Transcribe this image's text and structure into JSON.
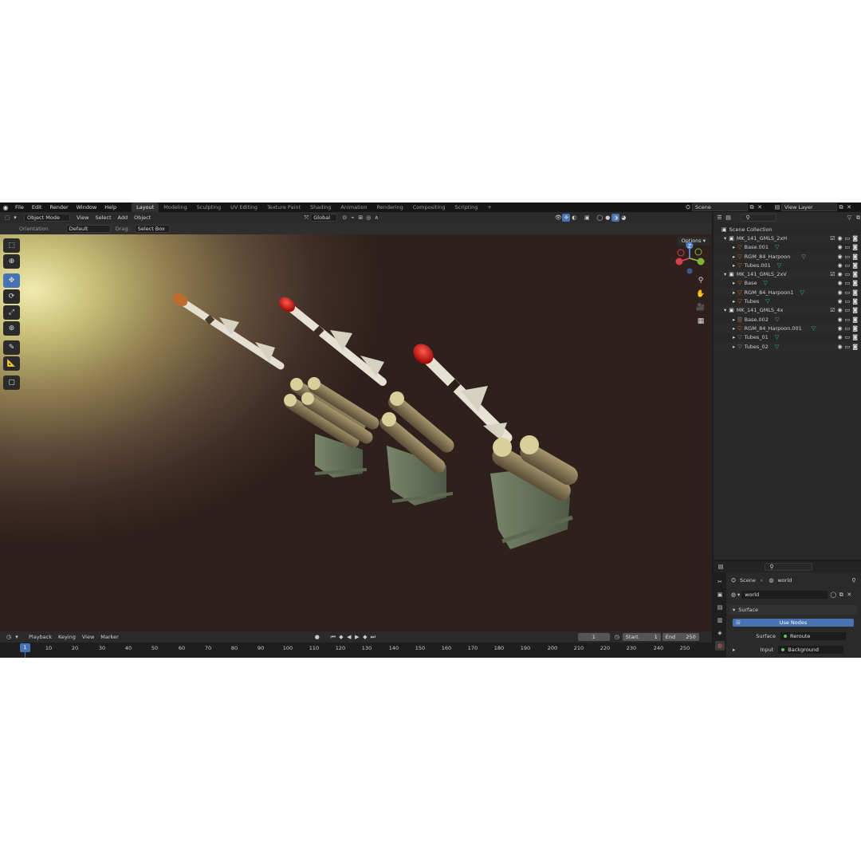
{
  "topbar": {
    "menu": [
      "File",
      "Edit",
      "Render",
      "Window",
      "Help"
    ],
    "workspaces": [
      "Layout",
      "Modeling",
      "Sculpting",
      "UV Editing",
      "Texture Paint",
      "Shading",
      "Animation",
      "Rendering",
      "Compositing",
      "Scripting"
    ],
    "add_tab": "+",
    "scene": "Scene",
    "view_layer": "View Layer"
  },
  "header": {
    "mode": "Object Mode",
    "menu": [
      "View",
      "Select",
      "Add",
      "Object"
    ],
    "transform_orientation": "Global"
  },
  "tool_settings": {
    "orientation_label": "Orientation",
    "orientation_value": "Default",
    "drag_label": "Drag:",
    "drag_value": "Select Box",
    "options": "Options"
  },
  "gizmo": {
    "x": "X",
    "y": "Y",
    "z": "Z"
  },
  "timeline": {
    "menu": [
      "Playback",
      "Keying",
      "View",
      "Marker"
    ],
    "current_frame": "1",
    "start_label": "Start",
    "start": "1",
    "end_label": "End",
    "end": "250",
    "playhead": "1",
    "ticks": [
      "10",
      "20",
      "30",
      "40",
      "50",
      "60",
      "70",
      "80",
      "90",
      "100",
      "110",
      "120",
      "130",
      "140",
      "150",
      "160",
      "170",
      "180",
      "190",
      "200",
      "210",
      "220",
      "230",
      "240",
      "250"
    ]
  },
  "outliner": {
    "root": "Scene Collection",
    "items": [
      {
        "label": "MK_141_GMLS_2xH",
        "type": "collection",
        "level": 1
      },
      {
        "label": "Base.001",
        "type": "object",
        "level": 2
      },
      {
        "label": "RGM_84_Harpoon",
        "type": "object",
        "level": 2
      },
      {
        "label": "Tubes.001",
        "type": "object",
        "level": 2
      },
      {
        "label": "MK_141_GMLS_2xV",
        "type": "collection",
        "level": 1
      },
      {
        "label": "Base",
        "type": "object",
        "level": 2
      },
      {
        "label": "RGM_84_Harpoon1",
        "type": "object",
        "level": 2
      },
      {
        "label": "Tubes",
        "type": "object",
        "level": 2
      },
      {
        "label": "MK_141_GMLS_4x",
        "type": "collection",
        "level": 1
      },
      {
        "label": "Base.002",
        "type": "object",
        "level": 2
      },
      {
        "label": "RGM_84_Harpoon.001",
        "type": "object",
        "level": 2
      },
      {
        "label": "Tubes_01",
        "type": "object",
        "level": 2
      },
      {
        "label": "Tubes_02",
        "type": "object",
        "level": 2
      }
    ]
  },
  "properties": {
    "breadcrumb_scene": "Scene",
    "breadcrumb_world": "world",
    "world_name": "world",
    "panel": "Surface",
    "use_nodes": "Use Nodes",
    "surface_label": "Surface",
    "surface_value": "Reroute",
    "input_label": "Input",
    "input_value": "Background"
  },
  "colors": {
    "accent": "#4772b3",
    "object": "#c06a2b",
    "mesh": "#2ec07a"
  }
}
